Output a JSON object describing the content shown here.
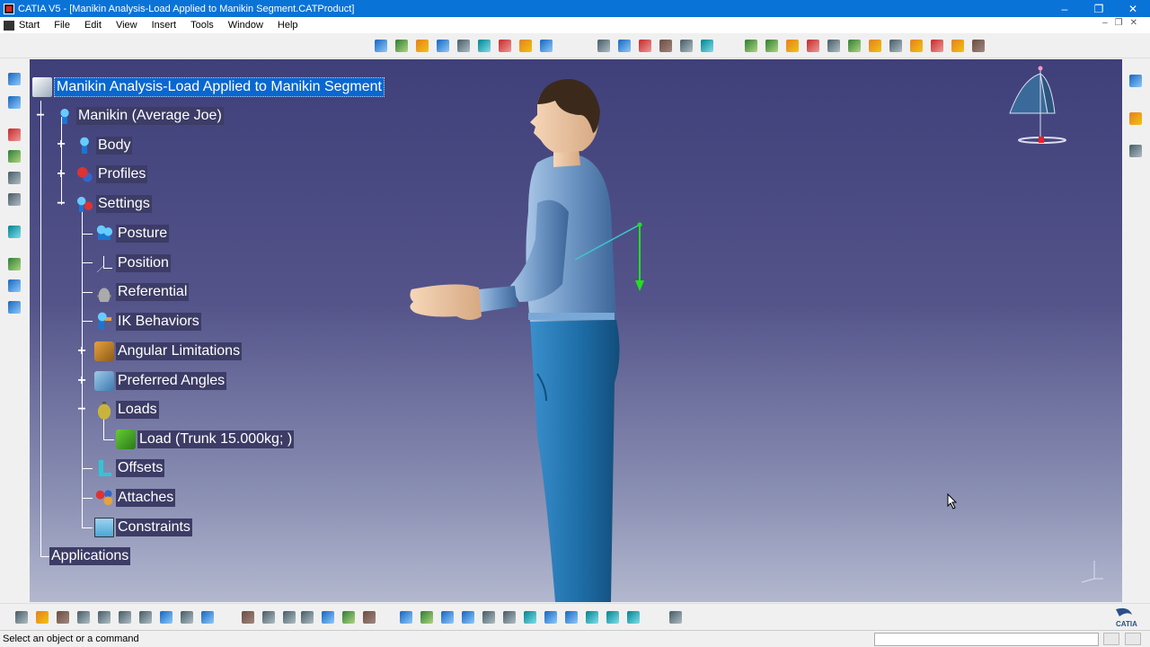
{
  "window": {
    "title": "CATIA V5 - [Manikin Analysis-Load Applied to Manikin Segment.CATProduct]",
    "controls": [
      "–",
      "❐",
      "✕"
    ]
  },
  "menu": {
    "items": [
      "Start",
      "File",
      "Edit",
      "View",
      "Insert",
      "Tools",
      "Window",
      "Help"
    ]
  },
  "tree": {
    "root": "Manikin Analysis-Load Applied to Manikin Segment",
    "manikin": "Manikin (Average Joe)",
    "body": "Body",
    "profiles": "Profiles",
    "settings": "Settings",
    "posture": "Posture",
    "position": "Position",
    "referential": "Referential",
    "ik_behaviors": "IK Behaviors",
    "angular_limitations": "Angular Limitations",
    "preferred_angles": "Preferred Angles",
    "loads": "Loads",
    "load_item": "Load (Trunk 15.000kg; )",
    "offsets": "Offsets",
    "attaches": "Attaches",
    "constraints": "Constraints",
    "applications": "Applications"
  },
  "status": {
    "message": "Select an object or a command"
  },
  "colors": {
    "title_bar": "#0a73d8",
    "selection": "#0a67d0",
    "viewport_top": "#3f3f7a",
    "viewport_bottom": "#b3b8cf"
  }
}
